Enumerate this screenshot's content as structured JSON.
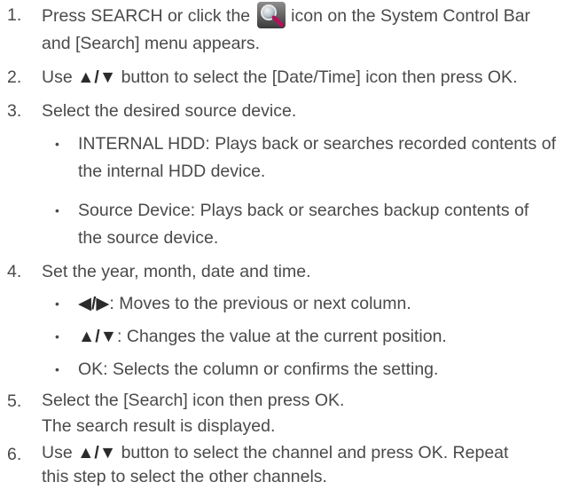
{
  "steps": [
    {
      "number": "1.",
      "line1_before_icon": "Press SEARCH or click the",
      "line1_after_icon": "icon on the System Control Bar",
      "line2": "and [Search] menu appears."
    },
    {
      "number": "2.",
      "before": "Use",
      "arrows": "▲/▼",
      "after": "button to select the [Date/Time] icon then press OK."
    },
    {
      "number": "3.",
      "text": "Select the desired source device.",
      "bullets": [
        {
          "line1": "INTERNAL HDD: Plays back or searches recorded contents of",
          "line2": "the internal HDD device."
        },
        {
          "line1": "Source Device: Plays back or searches backup contents of",
          "line2": "the source device."
        }
      ]
    },
    {
      "number": "4.",
      "text": "Set the year, month, date and time.",
      "bullets": [
        {
          "key": "◀/▶",
          "desc": ": Moves to the previous or next column."
        },
        {
          "key": "▲/▼",
          "desc": ": Changes the value at the current position."
        },
        {
          "key": "",
          "desc": "OK: Selects the column or confirms the setting."
        }
      ]
    },
    {
      "number": "5.",
      "line1": "Select the [Search] icon then press OK.",
      "line2": "The search result is displayed."
    },
    {
      "number": "6.",
      "before": "Use",
      "arrows": "▲/▼",
      "after": "button to select the channel and press OK. Repeat",
      "line2": "this step to select the other channels."
    }
  ],
  "bullet_char": "•",
  "icons": {
    "search": "search-magnifier-icon"
  }
}
